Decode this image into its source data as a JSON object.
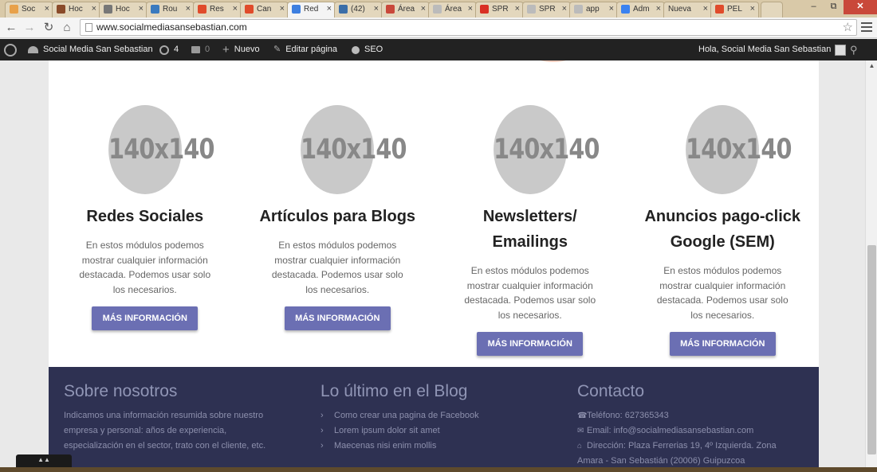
{
  "browser": {
    "tabs": [
      {
        "label": "Soc",
        "color": "#e8a14a"
      },
      {
        "label": "Hoc",
        "color": "#8a4b2a"
      },
      {
        "label": "Hoc",
        "color": "#777777"
      },
      {
        "label": "Rou",
        "color": "#3a7abf"
      },
      {
        "label": "Res",
        "color": "#e04b2b"
      },
      {
        "label": "Can",
        "color": "#e04b2b"
      },
      {
        "label": "Red",
        "color": "#3d7fe0",
        "active": true
      },
      {
        "label": "(42)",
        "color": "#3b6ea8"
      },
      {
        "label": "Área",
        "color": "#c9483a"
      },
      {
        "label": "Área",
        "color": "#bbbbbb"
      },
      {
        "label": "SPR",
        "color": "#d93025"
      },
      {
        "label": "SPR",
        "color": "#bbbbbb"
      },
      {
        "label": "app",
        "color": "#bbbbbb"
      },
      {
        "label": "Adm",
        "color": "#3b82f0"
      },
      {
        "label": "Nueva",
        "color": ""
      },
      {
        "label": "PEL",
        "color": "#e04b2b"
      }
    ],
    "url": "www.socialmediasansebastian.com"
  },
  "adminbar": {
    "site_name": "Social Media San Sebastian",
    "updates_count": "4",
    "comments_count": "0",
    "new_label": "Nuevo",
    "edit_label": "Editar página",
    "seo_label": "SEO",
    "greeting": "Hola, Social Media San Sebastian"
  },
  "features": [
    {
      "placeholder": "140x140",
      "title": "Redes Sociales",
      "desc": "En estos módulos podemos mostrar cualquier información destacada. Podemos usar solo los necesarios.",
      "button": "MÁS INFORMACIÓN"
    },
    {
      "placeholder": "140x140",
      "title": "Artículos para Blogs",
      "desc": "En estos módulos podemos mostrar cualquier información destacada. Podemos usar solo los necesarios.",
      "button": "MÁS INFORMACIÓN"
    },
    {
      "placeholder": "140x140",
      "title": "Newsletters/ Emailings",
      "desc": "En estos módulos podemos mostrar cualquier información destacada. Podemos usar solo los necesarios.",
      "button": "MÁS INFORMACIÓN"
    },
    {
      "placeholder": "140x140",
      "title": "Anuncios pago-click Google (SEM)",
      "desc": "En estos módulos podemos mostrar cualquier información destacada. Podemos usar solo los necesarios.",
      "button": "MÁS INFORMACIÓN"
    }
  ],
  "footer": {
    "about": {
      "title": "Sobre nosotros",
      "text": "Indicamos una información resumida sobre nuestro empresa y personal: años de experiencia, especialización en el sector, trato con el cliente, etc."
    },
    "blog": {
      "title": "Lo último en el Blog",
      "posts": [
        "Como crear una pagina de Facebook",
        "Lorem ipsum dolor sit amet",
        "Maecenas nisi enim mollis"
      ]
    },
    "contact": {
      "title": "Contacto",
      "phone": "Teléfono: 627365343",
      "email": "Email: info@socialmediasansebastian.com",
      "address": "Dirección: Plaza Ferrerias 19, 4º Izquierda. Zona Amara - San Sebastián (20006) Guipuzcoa"
    }
  },
  "colors": {
    "button": "#6b6fb3",
    "footer_bg": "#2e3152",
    "adminbar_bg": "#222222"
  }
}
